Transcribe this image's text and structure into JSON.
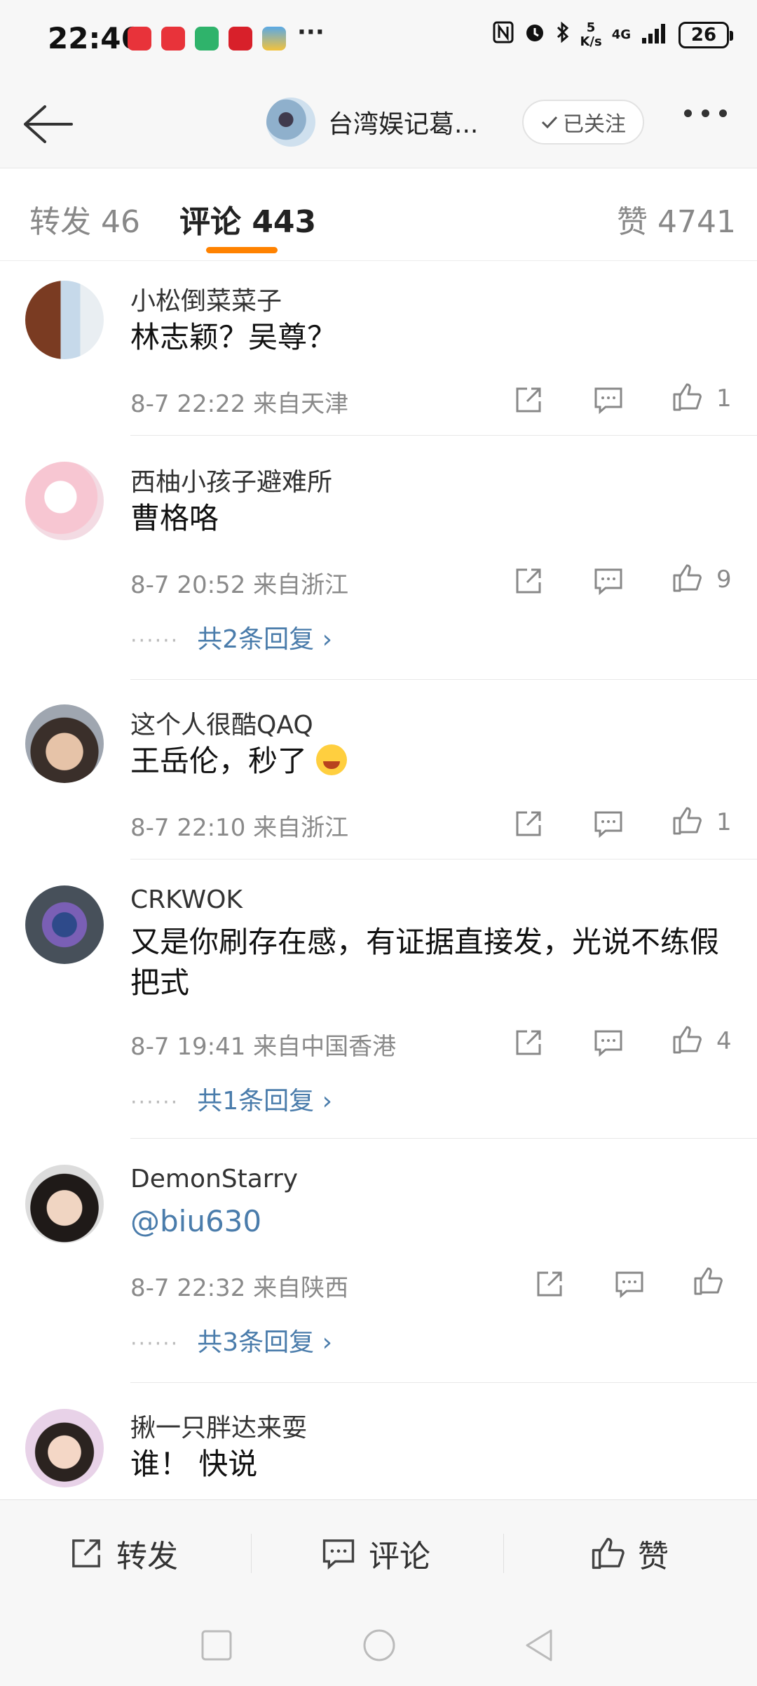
{
  "status_bar": {
    "time": "22:46",
    "more": "···",
    "speed_top": "5",
    "speed_bottom": "K/s",
    "network": "4G",
    "battery": "26"
  },
  "header": {
    "title": "台湾娱记葛...",
    "follow_label": "已关注"
  },
  "tabs": {
    "repost": "转发 46",
    "comments": "评论 443",
    "likes": "赞 4741"
  },
  "comments": [
    {
      "user": "小松倒菜菜子",
      "text": "林志颖？吴尊？",
      "time": "8-7 22:22",
      "location": "来自天津",
      "likes": "1"
    },
    {
      "user": "西柚小孩子避难所",
      "text": "曹格咯",
      "time": "8-7 20:52",
      "location": "来自浙江",
      "likes": "9",
      "replies": "共2条回复 ›"
    },
    {
      "user": "这个人很酷QAQ",
      "text": "王岳伦，秒了",
      "time": "8-7 22:10",
      "location": "来自浙江",
      "likes": "1"
    },
    {
      "user": "CRKWOK",
      "text": "又是你刷存在感，有证据直接发，光说不练假把式",
      "time": "8-7 19:41",
      "location": "来自中国香港",
      "likes": "4",
      "replies": "共1条回复 ›"
    },
    {
      "user": "DemonStarry",
      "text": "@biu630",
      "time": "8-7 22:32",
      "location": "来自陕西",
      "likes": "",
      "replies": "共3条回复 ›"
    },
    {
      "user": "揪一只胖达来耍",
      "text": "谁！ 快说"
    }
  ],
  "reply_dots": "······",
  "bottom_bar": {
    "repost": "转发",
    "comment": "评论",
    "like": "赞"
  },
  "colors": {
    "accent": "#ff8200",
    "link": "#4a7cab"
  }
}
